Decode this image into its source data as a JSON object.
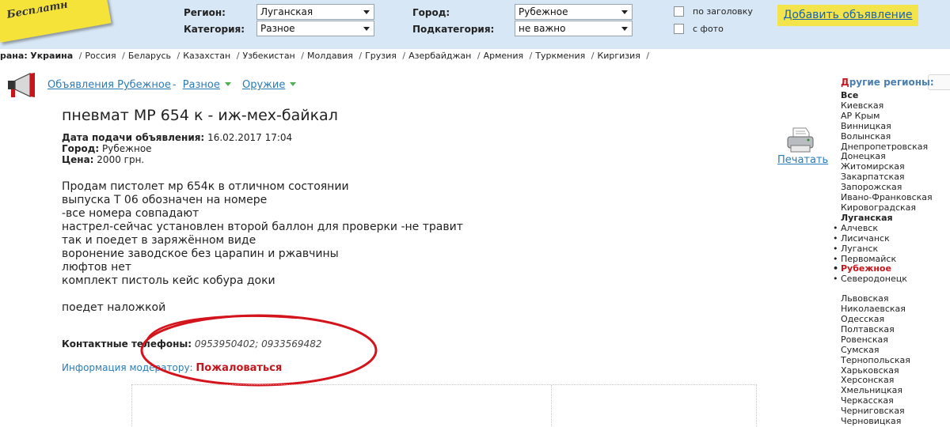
{
  "logo": {
    "text": "Бесплатн"
  },
  "filters": {
    "region_label": "Регион:",
    "region_value": "Луганская",
    "category_label": "Категория:",
    "category_value": "Разное",
    "city_label": "Город:",
    "city_value": "Рубежное",
    "subcategory_label": "Подкатегория:",
    "subcategory_value": "не важно",
    "by_title_label": "по заголовку",
    "with_photo_label": "с фото"
  },
  "add_button": "Добавить объявление",
  "countries": {
    "prefix": "рана:",
    "current": "Украина",
    "items": [
      "Россия",
      "Беларусь",
      "Казахстан",
      "Узбекистан",
      "Молдавия",
      "Грузия",
      "Азербайджан",
      "Армения",
      "Туркмения",
      "Киргизия"
    ]
  },
  "breadcrumb": {
    "ads": "Объявления Рубежное",
    "category": "Разное",
    "subcategory": "Оружие"
  },
  "ad": {
    "title": "пневмат МР 654 к - иж-мех-байкал",
    "date_label": "Дата подачи объявления:",
    "date_value": "16.02.2017 17:04",
    "city_label": "Город:",
    "city_value": "Рубежное",
    "price_label": "Цена:",
    "price_value": "2000 грн.",
    "print_label": "Печатать",
    "description": [
      "Продам пистолет мр 654к в отличном состоянии",
      "выпуска Т 06 обозначен на номере",
      "-все номера совпадают",
      "настрел-сейчас установлен второй баллон для проверки -не травит",
      "так и поедет в заряжённом виде",
      "воронение заводское без царапин и ржавчины",
      "люфтов нет",
      "комплект пистоль кейс кобура доки",
      "",
      "поедет наложкой"
    ],
    "phones_label": "Контактные телефоны:",
    "phones_value": "0953950402; 0933569482",
    "moderator_label": "Информация модератору:",
    "complain_label": "Пожаловаться"
  },
  "sidebar": {
    "title_first": "Д",
    "title_rest": "ругие регионы:",
    "regions_top": [
      "Все",
      "Киевская",
      "АР Крым",
      "Винницкая",
      "Волынская",
      "Днепропетровская",
      "Донецкая",
      "Житомирская",
      "Закарпатская",
      "Запорожская",
      "Ивано-Франковская",
      "Кировоградская"
    ],
    "current_region": "Луганская",
    "cities": [
      "Алчевск",
      "Лисичанск",
      "Луганск",
      "Первомайск",
      "Рубежное",
      "Северодонецк"
    ],
    "current_city": "Рубежное",
    "regions_bottom": [
      "Львовская",
      "Николаевская",
      "Одесская",
      "Полтавская",
      "Ровенская",
      "Сумская",
      "Тернопольская",
      "Харьковская",
      "Херсонская",
      "Хмельницкая",
      "Черкасская",
      "Черниговская",
      "Черновицкая"
    ]
  },
  "colors": {
    "header_bg": "#d7e7f5",
    "accent_yellow": "#f4e44c",
    "link_blue": "#2a7cb8",
    "alert_red": "#c4161c",
    "annotation_red": "#d4141c"
  }
}
